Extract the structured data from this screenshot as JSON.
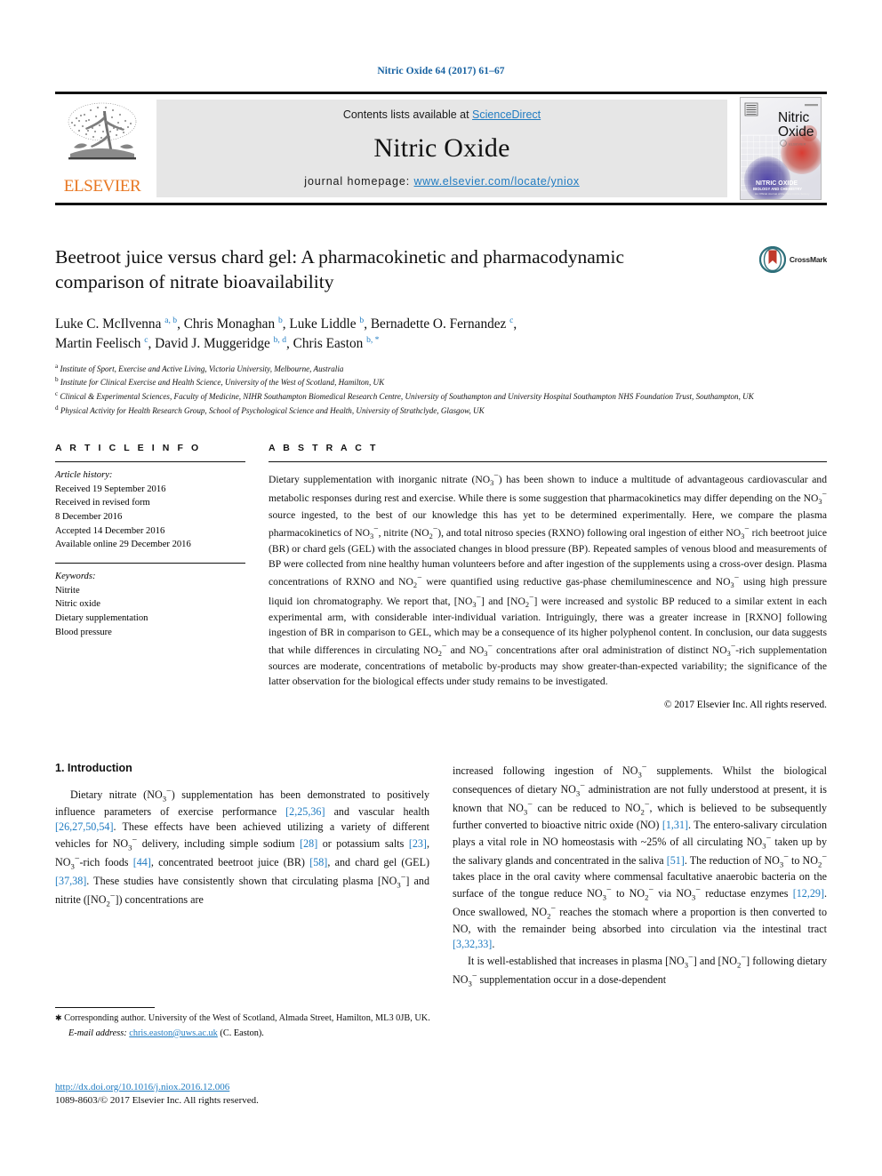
{
  "running_head": "Nitric Oxide 64 (2017) 61–67",
  "masthead": {
    "publisher_name": "ELSEVIER",
    "contents_prefix": "Contents lists available at ",
    "sciencedirect": "ScienceDirect",
    "journal_title": "Nitric Oxide",
    "homepage_label": "journal homepage: ",
    "homepage_url": "www.elsevier.com/locate/yniox",
    "cover_title_line1": "Nitric",
    "cover_title_line2": "Oxide",
    "cover_band_line1": "NITRIC OXIDE",
    "cover_band_line2": "BIOLOGY AND CHEMISTRY",
    "cover_band_line3": "An Official Journal of the Nitric Oxide Society",
    "link_color": "#1f7bc1",
    "elsevier_orange": "#e87722"
  },
  "article": {
    "title": "Beetroot juice versus chard gel: A pharmacokinetic and pharmacodynamic comparison of nitrate bioavailability",
    "crossmark_label": "CrossMark",
    "authors_line1_parts": [
      {
        "name": "Luke C. McIlvenna ",
        "sup": "a, b"
      },
      {
        "name": ", Chris Monaghan ",
        "sup": "b"
      },
      {
        "name": ", Luke Liddle ",
        "sup": "b"
      },
      {
        "name": ", Bernadette O. Fernandez ",
        "sup": "c"
      },
      {
        "name": ",",
        "sup": ""
      }
    ],
    "authors_line2_parts": [
      {
        "name": "Martin Feelisch ",
        "sup": "c"
      },
      {
        "name": ", David J. Muggeridge ",
        "sup": "b, d"
      },
      {
        "name": ", Chris Easton ",
        "sup": "b, *"
      }
    ],
    "affiliations": [
      {
        "marker": "a",
        "text": "Institute of Sport, Exercise and Active Living, Victoria University, Melbourne, Australia"
      },
      {
        "marker": "b",
        "text": "Institute for Clinical Exercise and Health Science, University of the West of Scotland, Hamilton, UK"
      },
      {
        "marker": "c",
        "text": "Clinical & Experimental Sciences, Faculty of Medicine, NIHR Southampton Biomedical Research Centre, University of Southampton and University Hospital Southampton NHS Foundation Trust, Southampton, UK"
      },
      {
        "marker": "d",
        "text": "Physical Activity for Health Research Group, School of Psychological Science and Health, University of Strathclyde, Glasgow, UK"
      }
    ]
  },
  "article_info": {
    "heading": "A R T I C L E   I N F O",
    "history_label": "Article history:",
    "history_lines": [
      "Received 19 September 2016",
      "Received in revised form",
      "8 December 2016",
      "Accepted 14 December 2016",
      "Available online 29 December 2016"
    ],
    "keywords_label": "Keywords:",
    "keywords": [
      "Nitrite",
      "Nitric oxide",
      "Dietary supplementation",
      "Blood pressure"
    ]
  },
  "abstract": {
    "heading": "A B S T R A C T",
    "text_html": "Dietary supplementation with inorganic nitrate (NO<sub>3</sub><sup>&#8722;</sup>) has been shown to induce a multitude of advantageous cardiovascular and metabolic responses during rest and exercise. While there is some suggestion that pharmacokinetics may differ depending on the NO<sub>3</sub><sup>&#8722;</sup> source ingested, to the best of our knowledge this has yet to be determined experimentally. Here, we compare the plasma pharmacokinetics of NO<sub>3</sub><sup>&#8722;</sup>, nitrite (NO<sub>2</sub><sup>&#8722;</sup>), and total nitroso species (RXNO) following oral ingestion of either NO<sub>3</sub><sup>&#8722;</sup> rich beetroot juice (BR) or chard gels (GEL) with the associated changes in blood pressure (BP). Repeated samples of venous blood and measurements of BP were collected from nine healthy human volunteers before and after ingestion of the supplements using a cross-over design. Plasma concentrations of RXNO and NO<sub>2</sub><sup>&#8722;</sup> were quantified using reductive gas-phase chemiluminescence and NO<sub>3</sub><sup>&#8722;</sup> using high pressure liquid ion chromatography. We report that, [NO<sub>3</sub><sup>&#8722;</sup>] and [NO<sub>2</sub><sup>&#8722;</sup>] were increased and systolic BP reduced to a similar extent in each experimental arm, with considerable inter-individual variation. Intriguingly, there was a greater increase in [RXNO] following ingestion of BR in comparison to GEL, which may be a consequence of its higher polyphenol content. In conclusion, our data suggests that while differences in circulating NO<sub>2</sub><sup>&#8722;</sup> and NO<sub>3</sub><sup>&#8722;</sup> concentrations after oral administration of distinct NO<sub>3</sub><sup>&#8722;</sup>-rich supplementation sources are moderate, concentrations of metabolic by-products may show greater-than-expected variability; the significance of the latter observation for the biological effects under study remains to be investigated.",
    "copyright": "&#169; 2017 Elsevier Inc. All rights reserved."
  },
  "body": {
    "section_heading": "1. Introduction",
    "left_paragraph_html": "Dietary nitrate (NO<sub>3</sub><sup>&#8722;</sup>) supplementation has been demonstrated to positively influence parameters of exercise performance <span class=\"ref\">[2,25,36]</span> and vascular health <span class=\"ref\">[26,27,50,54]</span>. These effects have been achieved utilizing a variety of different vehicles for NO<sub>3</sub><sup>&#8722;</sup> delivery, including simple sodium <span class=\"ref\">[28]</span> or potassium salts <span class=\"ref\">[23]</span>, NO<sub>3</sub><sup>&#8722;</sup>-rich foods <span class=\"ref\">[44]</span>, concentrated beetroot juice (BR) <span class=\"ref\">[58]</span>, and chard gel (GEL) <span class=\"ref\">[37,38]</span>. These studies have consistently shown that circulating plasma [NO<sub>3</sub><sup>&#8722;</sup>] and nitrite ([NO<sub>2</sub><sup>&#8722;</sup>]) concentrations are",
    "right_paragraph_1_html": "increased following ingestion of NO<sub>3</sub><sup>&#8722;</sup> supplements. Whilst the biological consequences of dietary NO<sub>3</sub><sup>&#8722;</sup> administration are not fully understood at present, it is known that NO<sub>3</sub><sup>&#8722;</sup> can be reduced to NO<sub>2</sub><sup>&#8722;</sup>, which is believed to be subsequently further converted to bioactive nitric oxide (NO) <span class=\"ref\">[1,31]</span>. The entero-salivary circulation plays a vital role in NO homeostasis with ~25% of all circulating NO<sub>3</sub><sup>&#8722;</sup> taken up by the salivary glands and concentrated in the saliva <span class=\"ref\">[51]</span>. The reduction of NO<sub>3</sub><sup>&#8722;</sup> to NO<sub>2</sub><sup>&#8722;</sup> takes place in the oral cavity where commensal facultative anaerobic bacteria on the surface of the tongue reduce NO<sub>3</sub><sup>&#8722;</sup> to NO<sub>2</sub><sup>&#8722;</sup> via NO<sub>3</sub><sup>&#8722;</sup> reductase enzymes <span class=\"ref\">[12,29]</span>. Once swallowed, NO<sub>2</sub><sup>&#8722;</sup> reaches the stomach where a proportion is then converted to NO, with the remainder being absorbed into circulation via the intestinal tract <span class=\"ref\">[3,32,33]</span>.",
    "right_paragraph_2_html": "It is well-established that increases in plasma [NO<sub>3</sub><sup>&#8722;</sup>] and [NO<sub>2</sub><sup>&#8722;</sup>] following dietary NO<sub>3</sub><sup>&#8722;</sup> supplementation occur in a dose-dependent"
  },
  "footer": {
    "corresponding_note": "Corresponding author. University of the West of Scotland, Almada Street, Hamilton, ML3 0JB, UK.",
    "email_label": "E-mail address:",
    "email": "chris.easton@uws.ac.uk",
    "email_attribution": "(C. Easton).",
    "doi": "http://dx.doi.org/10.1016/j.niox.2016.12.006",
    "issn_line": "1089-8603/© 2017 Elsevier Inc. All rights reserved."
  }
}
